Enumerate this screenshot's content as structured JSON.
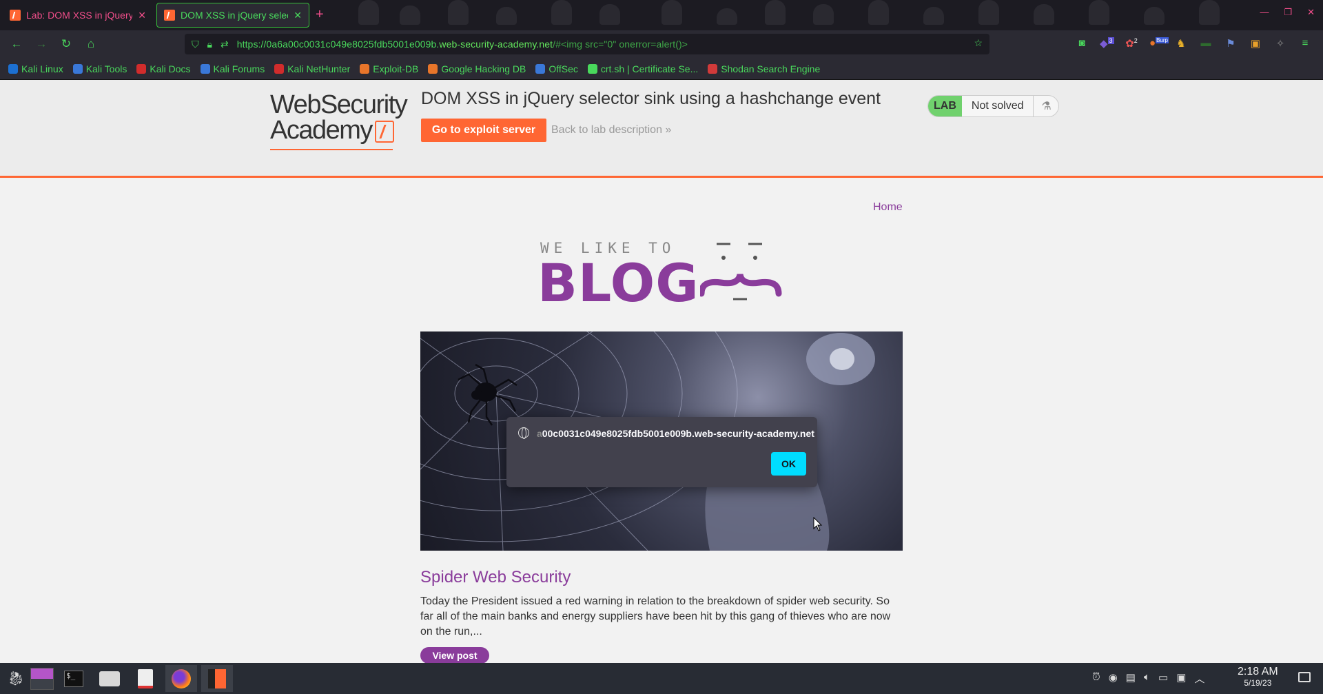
{
  "browser": {
    "tabs": [
      {
        "title": "Lab: DOM XSS in jQuery se",
        "active": false
      },
      {
        "title": "DOM XSS in jQuery selecto",
        "active": true
      }
    ],
    "new_tab_symbol": "+",
    "url_prefix": "https://0a6a00c0031c049e8025fdb5001e009b.",
    "url_host": "web-security-academy.net",
    "url_suffix": "/#<img src=\"0\" onerror=alert()>",
    "bookmarks": [
      {
        "label": "Kali Linux",
        "color": "#1c6fd1"
      },
      {
        "label": "Kali Tools",
        "color": "#3a78d8"
      },
      {
        "label": "Kali Docs",
        "color": "#d12c2c"
      },
      {
        "label": "Kali Forums",
        "color": "#3a78d8"
      },
      {
        "label": "Kali NetHunter",
        "color": "#d12c2c"
      },
      {
        "label": "Exploit-DB",
        "color": "#e8752a"
      },
      {
        "label": "Google Hacking DB",
        "color": "#e8752a"
      },
      {
        "label": "OffSec",
        "color": "#3a78d8"
      },
      {
        "label": "crt.sh | Certificate Se...",
        "color": "#49d85c"
      },
      {
        "label": "Shodan Search Engine",
        "color": "#d13a3a"
      }
    ],
    "extension_badges": {
      "badge_a": "3",
      "badge_b": "2",
      "badge_c": "Burp"
    }
  },
  "lab": {
    "logo_line1": "WebSecurity",
    "logo_line2": "Academy",
    "title": "DOM XSS in jQuery selector sink using a hashchange event",
    "exploit_button": "Go to exploit server",
    "back_link": "Back to lab description",
    "badge": "LAB",
    "status": "Not solved"
  },
  "blog": {
    "home_link": "Home",
    "tagline": "WE LIKE TO",
    "word": "BLOG",
    "post": {
      "title": "Spider Web Security",
      "text": "Today the President issued a red warning in relation to the breakdown of spider web security. So far all of the main banks and energy suppliers have been hit by this gang of thieves who are now on the run,...",
      "button": "View post"
    }
  },
  "dialog": {
    "origin_faded": "a",
    "origin": "00c0031c049e8025fdb5001e009b.web-security-academy.net",
    "ok": "OK"
  },
  "taskbar": {
    "time": "2:18 AM",
    "date": "5/19/23"
  },
  "colors": {
    "accent_orange": "#ff6633",
    "blog_purple": "#8a3c9b",
    "browser_green": "#49d85c",
    "dialog_ok": "#00ddff"
  }
}
